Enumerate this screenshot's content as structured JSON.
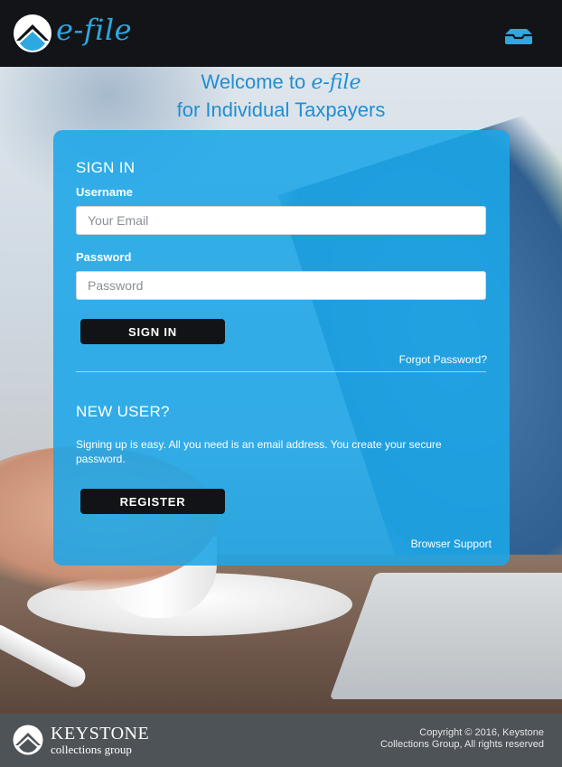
{
  "header": {
    "brand": "e-file",
    "tray_icon": "inbox-tray-icon",
    "colors": {
      "bar": "#131417",
      "accent": "#2ea8e0"
    }
  },
  "welcome": {
    "line1_prefix": "Welcome to ",
    "line1_brand": "e-file",
    "line2": "for Individual Taxpayers"
  },
  "signin": {
    "heading": "SIGN IN",
    "username_label": "Username",
    "username_placeholder": "Your Email",
    "username_value": "",
    "password_label": "Password",
    "password_placeholder": "Password",
    "password_value": "",
    "button_label": "SIGN IN",
    "forgot_link": "Forgot Password?"
  },
  "newuser": {
    "heading": "NEW USER?",
    "description": "Signing up is easy. All you need is an email address. You create your secure password.",
    "button_label": "REGISTER",
    "browser_support_link": "Browser Support"
  },
  "footer": {
    "company_name": "KEYSTONE",
    "company_sub": "collections group",
    "copyright_line1": "Copyright © 2016, Keystone",
    "copyright_line2": "Collections Group, All rights reserved",
    "colors": {
      "panel": "#1ca6e8",
      "footer_bg": "#4e5358"
    }
  }
}
